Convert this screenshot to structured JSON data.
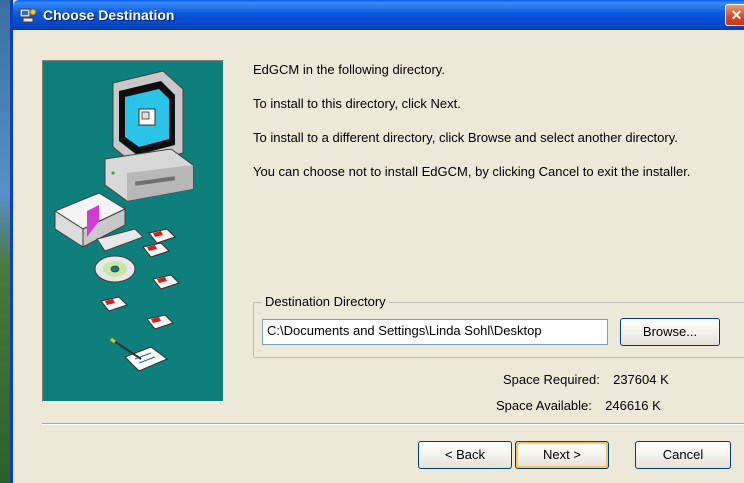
{
  "window": {
    "title": "Choose Destination",
    "close_glyph": "✕"
  },
  "body": {
    "paragraphs": [
      "EdGCM in the following directory.",
      "To install to this directory, click Next.",
      "To install to a different directory, click Browse and select another directory.",
      "You can choose not to install EdGCM, by clicking Cancel to exit the installer."
    ]
  },
  "destination": {
    "group_label": "Destination Directory",
    "path": "C:\\Documents and Settings\\Linda Sohl\\Desktop",
    "browse_label": "Browse..."
  },
  "space": {
    "required_label": "Space Required:",
    "required_value": "237604 K",
    "available_label": "Space Available:",
    "available_value": "246616 K"
  },
  "buttons": {
    "back": "< Back",
    "next": "Next >",
    "cancel": "Cancel"
  },
  "colors": {
    "title_bar": "#0857dd",
    "dialog_bg": "#ece9d8",
    "art_panel": "#0f7f7c"
  },
  "icons": {
    "title": "installer-icon",
    "close": "close-icon"
  }
}
